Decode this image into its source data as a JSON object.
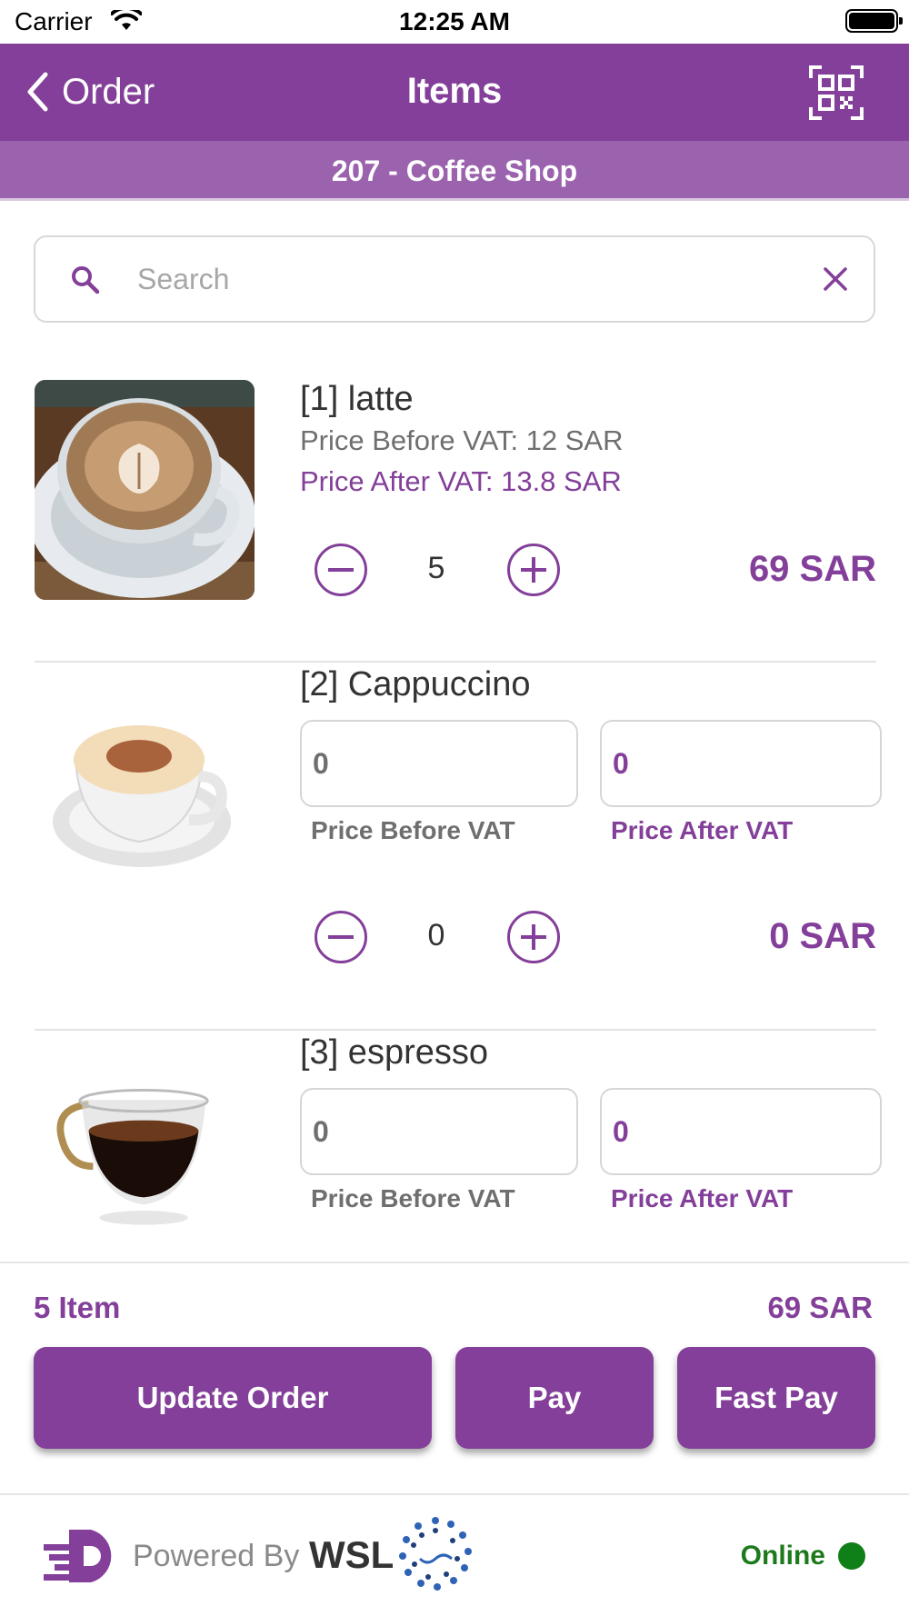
{
  "status_bar": {
    "carrier": "Carrier",
    "time": "12:25 AM"
  },
  "nav": {
    "back_label": "Order",
    "title": "Items"
  },
  "subheader": "207 - Coffee Shop",
  "search": {
    "placeholder": "Search",
    "value": ""
  },
  "items": [
    {
      "name": "[1] latte",
      "price_before_vat": "Price Before VAT: 12 SAR",
      "price_after_vat": "Price After VAT: 13.8 SAR",
      "quantity": "5",
      "line_total": "69 SAR"
    },
    {
      "name": "[2] Cappuccino",
      "price_before_value": "0",
      "price_after_value": "0",
      "price_before_label": "Price Before VAT",
      "price_after_label": "Price After VAT",
      "quantity": "0",
      "line_total": "0 SAR"
    },
    {
      "name": "[3] espresso",
      "price_before_value": "0",
      "price_after_value": "0",
      "price_before_label": "Price Before VAT",
      "price_after_label": "Price After VAT"
    }
  ],
  "summary": {
    "item_count": "5 Item",
    "total": "69 SAR"
  },
  "actions": {
    "update_order": "Update Order",
    "pay": "Pay",
    "fast_pay": "Fast Pay"
  },
  "footer": {
    "powered_by": "Powered By",
    "brand": "WSL",
    "status": "Online"
  },
  "colors": {
    "primary": "#833f99",
    "subheader": "#9b62ad",
    "online": "#0f7f17"
  },
  "icons": [
    "wifi-icon",
    "battery-icon",
    "back-chevron-icon",
    "qr-code-icon",
    "search-icon",
    "clear-icon",
    "minus-circle-icon",
    "plus-circle-icon",
    "wsl-logo-icon"
  ]
}
